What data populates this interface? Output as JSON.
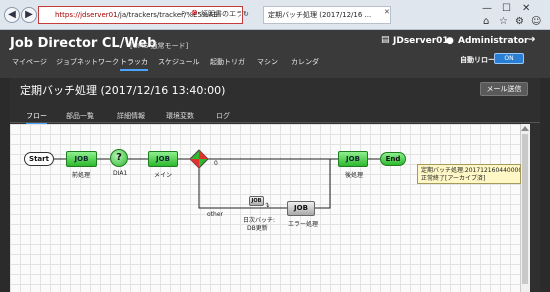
{
  "browser": {
    "url_host": "https://jdserver01",
    "url_path": "/ja/trackers/tracker/%E5%AE",
    "cert_error": "証明書のエラー",
    "tab_title": "定期バッチ処理 (2017/12/16 ...",
    "back_glyph": "◀",
    "forward_glyph": "▶",
    "search_glyph": "⌕",
    "refresh_glyph": "↻",
    "close_glyph": "✕",
    "min_glyph": "—",
    "max_glyph": "☐",
    "home_glyph": "⌂",
    "star_glyph": "☆",
    "gear_glyph": "⚙",
    "smile_glyph": "☺"
  },
  "app": {
    "title": "Job Director CL/Web",
    "mode": "[UMS 通常モード]",
    "server": "JDserver01",
    "user": "Administrator",
    "server_glyph": "▤",
    "user_glyph": "●",
    "logout_glyph": "➜",
    "auto_reload_label": "自動リロード",
    "toggle_label": "ON"
  },
  "menu": {
    "items": [
      "マイページ",
      "ジョブネットワーク",
      "トラッカ",
      "スケジュール",
      "起動トリガ",
      "マシン",
      "カレンダ"
    ]
  },
  "page": {
    "title": "定期バッチ処理 (2017/12/16 13:40:00)",
    "mail_button": "メール送信",
    "subtabs": [
      "フロー",
      "部品一覧",
      "詳細情報",
      "環境変数",
      "ログ"
    ]
  },
  "flow": {
    "start": "Start",
    "end": "End",
    "job": "JOB",
    "question": "?",
    "job_pre_label": "前処理",
    "dialog_label": "DIA1",
    "job_main_label": "メイン",
    "branch_zero_label": "0",
    "job_post_label": "後処理",
    "branch_other_label": "other",
    "job_small": "JOB",
    "daily_batch_line1": "日次バッチ:",
    "daily_batch_line2": "DB更新",
    "error_label": "エラー処理",
    "tooltip_line1": "定期バッチ処理.201712160440000",
    "tooltip_line2": "正常終了[アーカイブ済]"
  },
  "colors": {
    "accent": "#4aa3ff",
    "job_green": "#2db82d",
    "header_bg": "#3a3a3a",
    "tooltip_bg": "#fff8c6"
  }
}
